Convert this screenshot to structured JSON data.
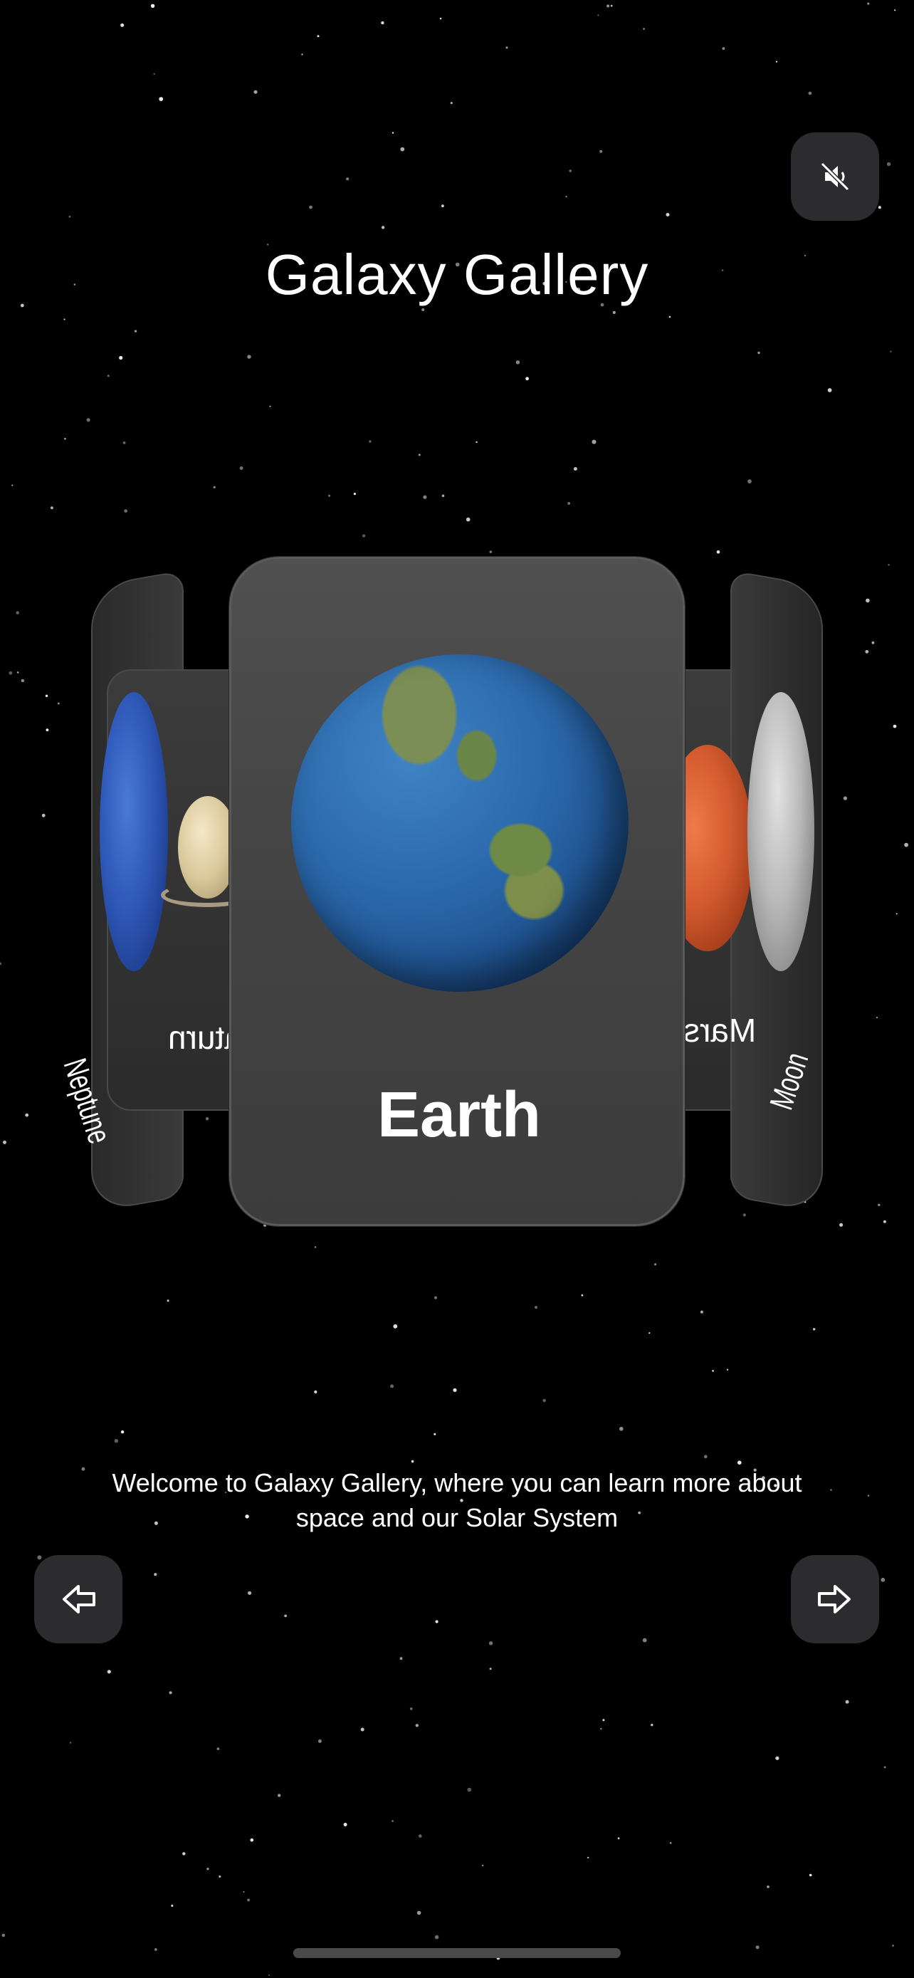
{
  "app": {
    "title": "Galaxy Gallery"
  },
  "controls": {
    "mute_icon": "speaker-muted-icon",
    "prev_icon": "arrow-left-icon",
    "next_icon": "arrow-right-icon"
  },
  "carousel": {
    "selected": {
      "label": "Earth"
    },
    "left_cards": [
      {
        "label": "Neptune"
      },
      {
        "label": "Saturn"
      }
    ],
    "right_cards": [
      {
        "label": "Mars"
      },
      {
        "label": "Moon"
      }
    ]
  },
  "welcome": {
    "line1": "Welcome to Galaxy Gallery, where you can learn more about",
    "line2": "space and our Solar System"
  },
  "colors": {
    "background": "#000000",
    "button": "#2c2c2e",
    "card": "#4a4a4a"
  }
}
